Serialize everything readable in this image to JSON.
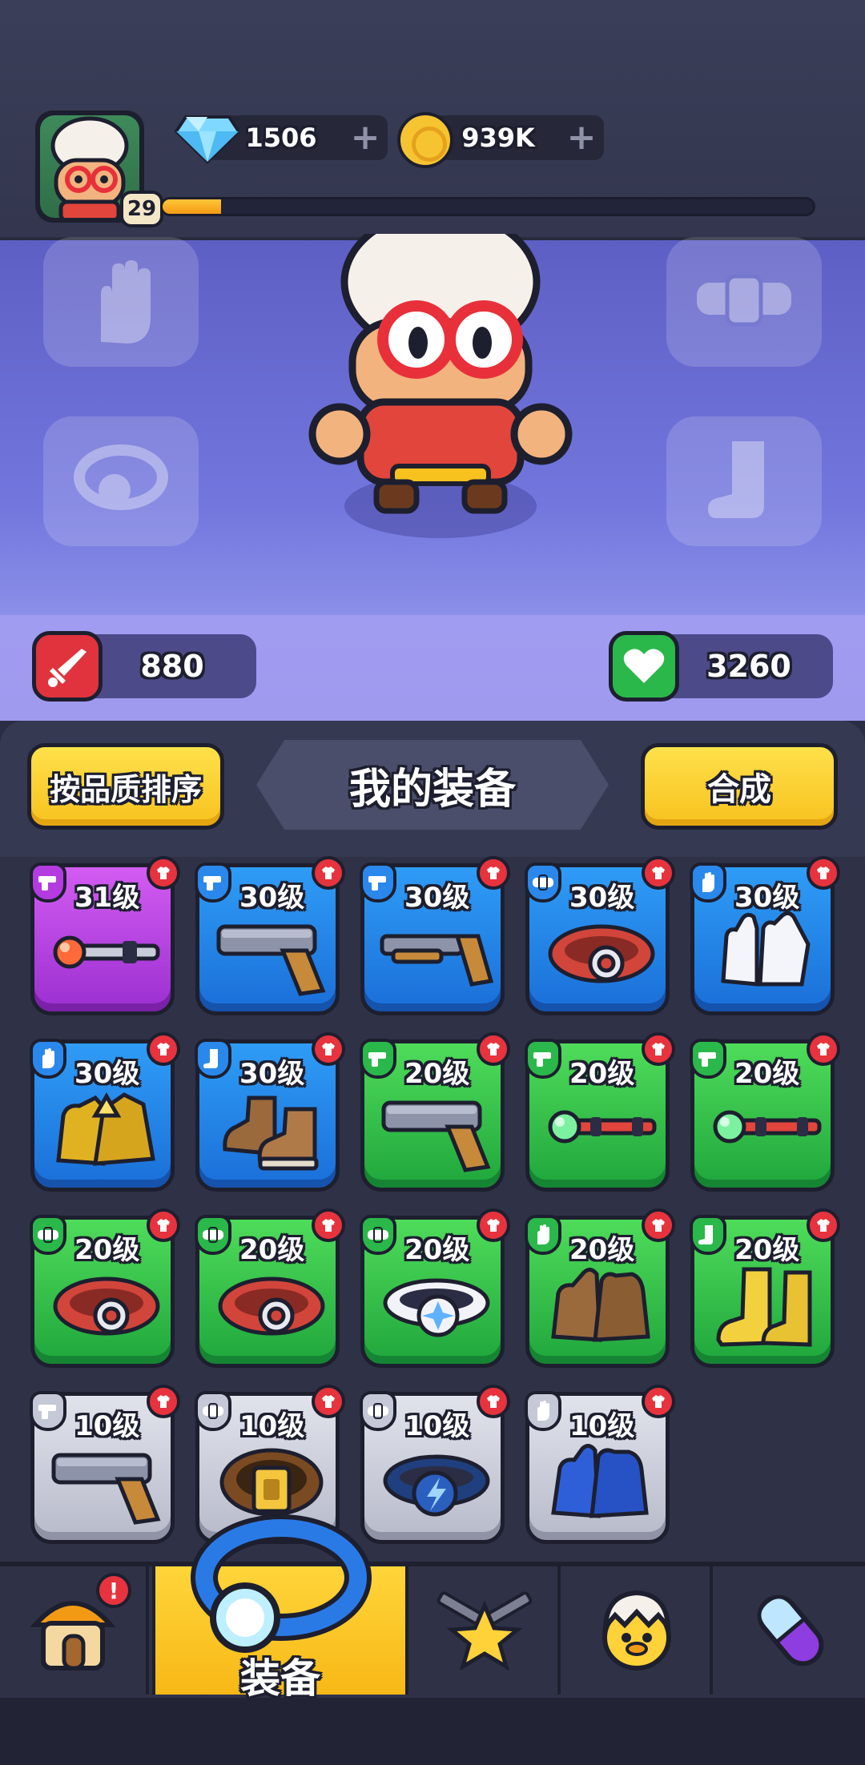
{
  "header": {
    "player_level": "29",
    "xp_progress_fraction": 0.09,
    "gems": "1506",
    "coins": "939K",
    "plus": "+"
  },
  "stats": {
    "attack": "880",
    "health": "3260"
  },
  "equipment_panel": {
    "sort_button": "按品质排序",
    "title": "我的装备",
    "merge_button": "合成"
  },
  "items": [
    {
      "level": "31级",
      "rarity": "purple",
      "type": "weapon",
      "art": "staff-red"
    },
    {
      "level": "30级",
      "rarity": "blue",
      "type": "weapon",
      "art": "pistol"
    },
    {
      "level": "30级",
      "rarity": "blue",
      "type": "weapon",
      "art": "shotgun"
    },
    {
      "level": "30级",
      "rarity": "blue",
      "type": "belt",
      "art": "belt-red"
    },
    {
      "level": "30级",
      "rarity": "blue",
      "type": "glove",
      "art": "gloves-white"
    },
    {
      "level": "30级",
      "rarity": "blue",
      "type": "glove",
      "art": "gloves-gold"
    },
    {
      "level": "30级",
      "rarity": "blue",
      "type": "boot",
      "art": "boots-brown"
    },
    {
      "level": "20级",
      "rarity": "green",
      "type": "weapon",
      "art": "pistol"
    },
    {
      "level": "20级",
      "rarity": "green",
      "type": "weapon",
      "art": "staff-green"
    },
    {
      "level": "20级",
      "rarity": "green",
      "type": "weapon",
      "art": "staff-green"
    },
    {
      "level": "20级",
      "rarity": "green",
      "type": "belt",
      "art": "belt-red"
    },
    {
      "level": "20级",
      "rarity": "green",
      "type": "belt",
      "art": "belt-red"
    },
    {
      "level": "20级",
      "rarity": "green",
      "type": "belt",
      "art": "belt-white"
    },
    {
      "level": "20级",
      "rarity": "green",
      "type": "glove",
      "art": "gloves-brown"
    },
    {
      "level": "20级",
      "rarity": "green",
      "type": "boot",
      "art": "boots-yellow"
    },
    {
      "level": "10级",
      "rarity": "gray",
      "type": "weapon",
      "art": "pistol"
    },
    {
      "level": "10级",
      "rarity": "gray",
      "type": "belt",
      "art": "belt-brown"
    },
    {
      "level": "10级",
      "rarity": "gray",
      "type": "belt",
      "art": "belt-blue"
    },
    {
      "level": "10级",
      "rarity": "gray",
      "type": "glove",
      "art": "gloves-blue"
    }
  ],
  "nav": {
    "tabs": [
      {
        "name": "shop-tab",
        "icon": "house-icon"
      },
      {
        "name": "equipment-tab",
        "icon": "ring-icon",
        "label": "装备",
        "active": true
      },
      {
        "name": "talent-tab",
        "icon": "star-guns-icon"
      },
      {
        "name": "pet-tab",
        "icon": "chick-egg-icon"
      },
      {
        "name": "potion-tab",
        "icon": "capsule-icon"
      }
    ],
    "shop_notification": "!"
  },
  "colors": {
    "accent_yellow": "#f7c21e",
    "rarity_purple": "#b43be0",
    "rarity_blue": "#2a88ec",
    "rarity_green": "#2bb84a",
    "rarity_gray": "#c5c8d6",
    "alert_red": "#e6333d"
  }
}
